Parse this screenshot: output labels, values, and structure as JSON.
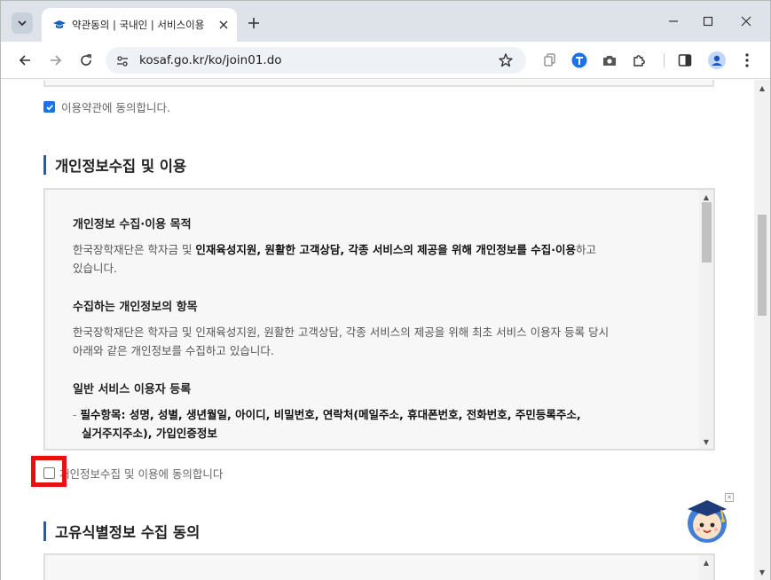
{
  "browser": {
    "tab_title": "약관동의 | 국내인 | 서비스이용자 등록",
    "url": "kosaf.go.kr/ko/join01.do",
    "icons": {
      "tab_dropdown": "chevron-down-icon",
      "favicon": "graduation-cap-icon",
      "tab_close": "close-icon",
      "new_tab": "plus-icon",
      "minimize": "minimize-icon",
      "maximize": "maximize-icon",
      "close": "close-icon",
      "back": "arrow-left-icon",
      "forward": "arrow-right-icon",
      "reload": "reload-icon",
      "site_info": "tune-icon",
      "bookmark": "star-icon",
      "copy": "copy-icon",
      "translate": "translate-icon",
      "screenshot": "camera-icon",
      "extensions": "puzzle-icon",
      "sidepanel": "sidepanel-icon",
      "profile": "profile-icon",
      "menu": "more-vert-icon"
    }
  },
  "page": {
    "terms_agree_label": "이용약관에 동의합니다.",
    "privacy": {
      "section_title": "개인정보수집 및 이용",
      "purpose_heading": "개인정보 수집·이용 목적",
      "purpose_text_1": "한국장학재단은 학자금 및 ",
      "purpose_text_bold": "인재육성지원, 원활한 고객상담, 각종 서비스의 제공을 위해 개인정보를 수집·이용",
      "purpose_text_2": "하고",
      "purpose_text_3": "있습니다.",
      "items_heading": "수집하는 개인정보의 항목",
      "items_text_1": "한국장학재단은 학자금 및 인재육성지원, 원활한 고객상담, 각종 서비스의 제공을 위해 최초 서비스 이용자 등록 당시",
      "items_text_2": "아래와 같은 개인정보를 수집하고 있습니다.",
      "general_heading": "일반 서비스 이용자 등록",
      "required_dash": "- ",
      "required_line_1": "필수항목: 성명, 성별, 생년월일, 아이디, 비밀번호, 연락처(메일주소, 휴대폰번호, 전화번호, 주민등록주소,",
      "required_line_2": "실거주지주소), 가입인증정보",
      "agree_label": "개인정보수집 및 이용에 동의합니다"
    },
    "unique_id": {
      "section_title": "고유식별정보 수집 동의"
    },
    "accent_color": "#1a5fb4",
    "highlight_color": "#e81010"
  }
}
